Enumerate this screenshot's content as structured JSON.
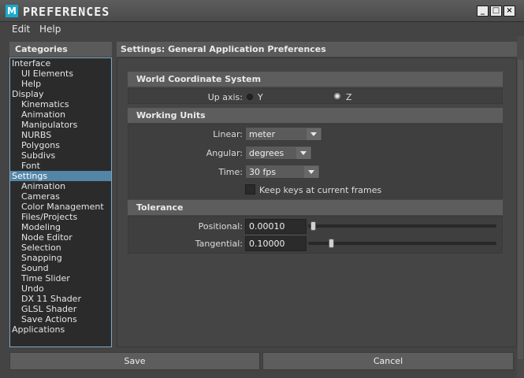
{
  "window": {
    "app_icon_letter": "M",
    "title": "PREFERENCES",
    "controls": {
      "minimize": "_",
      "maximize": "□",
      "close": "×"
    }
  },
  "menu": [
    {
      "label": "Edit"
    },
    {
      "label": "Help"
    }
  ],
  "categories": {
    "header": "Categories",
    "items": [
      {
        "label": "Interface",
        "level": 0
      },
      {
        "label": "UI Elements",
        "level": 1
      },
      {
        "label": "Help",
        "level": 1
      },
      {
        "label": "Display",
        "level": 0
      },
      {
        "label": "Kinematics",
        "level": 1
      },
      {
        "label": "Animation",
        "level": 1
      },
      {
        "label": "Manipulators",
        "level": 1
      },
      {
        "label": "NURBS",
        "level": 1
      },
      {
        "label": "Polygons",
        "level": 1
      },
      {
        "label": "Subdivs",
        "level": 1
      },
      {
        "label": "Font",
        "level": 1
      },
      {
        "label": "Settings",
        "level": 0,
        "selected": true
      },
      {
        "label": "Animation",
        "level": 1
      },
      {
        "label": "Cameras",
        "level": 1
      },
      {
        "label": "Color Management",
        "level": 1
      },
      {
        "label": "Files/Projects",
        "level": 1
      },
      {
        "label": "Modeling",
        "level": 1
      },
      {
        "label": "Node Editor",
        "level": 1
      },
      {
        "label": "Selection",
        "level": 1
      },
      {
        "label": "Snapping",
        "level": 1
      },
      {
        "label": "Sound",
        "level": 1
      },
      {
        "label": "Time Slider",
        "level": 1
      },
      {
        "label": "Undo",
        "level": 1
      },
      {
        "label": "DX 11 Shader",
        "level": 1
      },
      {
        "label": "GLSL Shader",
        "level": 1
      },
      {
        "label": "Save Actions",
        "level": 1
      },
      {
        "label": "Applications",
        "level": 0
      }
    ]
  },
  "settings": {
    "header": "Settings: General Application Preferences",
    "world_coordinate": {
      "title": "World Coordinate System",
      "up_axis_label": "Up axis:",
      "options": [
        "Y",
        "Z"
      ],
      "selected": "Z"
    },
    "working_units": {
      "title": "Working Units",
      "linear_label": "Linear:",
      "linear_value": "meter",
      "angular_label": "Angular:",
      "angular_value": "degrees",
      "time_label": "Time:",
      "time_value": "30 fps",
      "keep_keys_label": "Keep keys at current frames",
      "keep_keys_checked": false
    },
    "tolerance": {
      "title": "Tolerance",
      "positional_label": "Positional:",
      "positional_value": "0.00010",
      "positional_slider": 0.0,
      "tangential_label": "Tangential:",
      "tangential_value": "0.10000",
      "tangential_slider": 0.1
    }
  },
  "buttons": {
    "save": "Save",
    "cancel": "Cancel"
  },
  "colors": {
    "selection": "#5285a6",
    "app_icon": "#18a9cf"
  }
}
